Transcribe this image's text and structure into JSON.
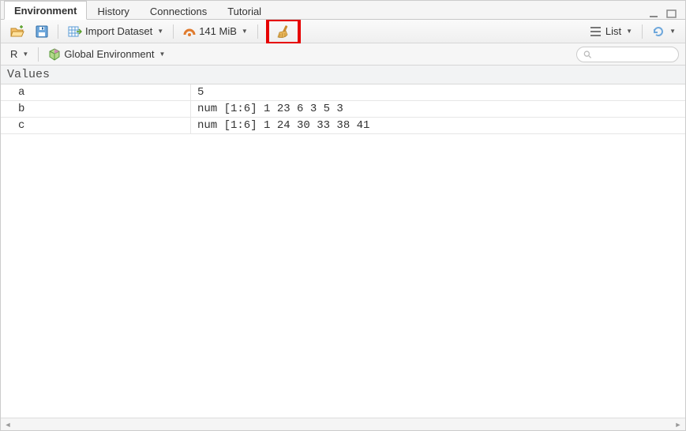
{
  "tabs": [
    "Environment",
    "History",
    "Connections",
    "Tutorial"
  ],
  "toolbar": {
    "import_label": "Import Dataset",
    "memory": "141 MiB",
    "view_mode": "List"
  },
  "scope": {
    "language": "R",
    "env": "Global Environment",
    "search_placeholder": ""
  },
  "section_title": "Values",
  "vars": [
    {
      "name": "a",
      "value": "5"
    },
    {
      "name": "b",
      "value": "num [1:6] 1 23 6 3 5 3"
    },
    {
      "name": "c",
      "value": "num [1:6] 1 24 30 33 38 41"
    }
  ]
}
